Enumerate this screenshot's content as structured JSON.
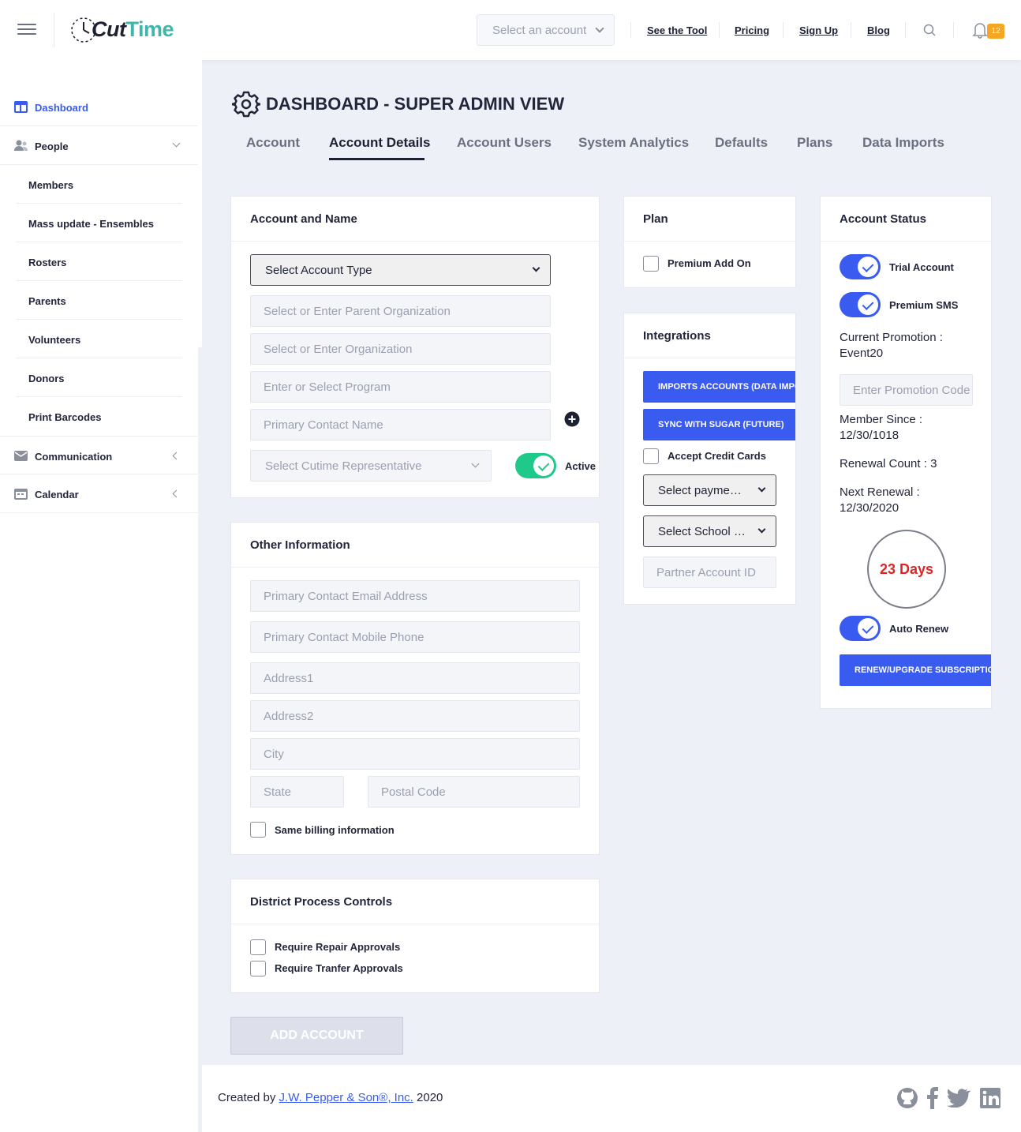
{
  "header": {
    "logo_prefix": "Cut",
    "logo_suffix": "Time",
    "account_select_placeholder": "Select an account",
    "nav": [
      {
        "label": "See the Tool"
      },
      {
        "label": "Pricing"
      },
      {
        "label": "Sign Up"
      },
      {
        "label": "Blog"
      }
    ],
    "notification_count": "12"
  },
  "sidebar": {
    "items": [
      {
        "label": "Dashboard",
        "icon": "dashboard-icon",
        "active": true
      },
      {
        "label": "People",
        "icon": "people-icon"
      },
      {
        "label": "Communication",
        "icon": "mail-icon"
      },
      {
        "label": "Calendar",
        "icon": "calendar-icon"
      }
    ],
    "people_sub": [
      {
        "label": "Members"
      },
      {
        "label": "Mass update - Ensembles"
      },
      {
        "label": "Rosters"
      },
      {
        "label": "Parents"
      },
      {
        "label": "Volunteers"
      },
      {
        "label": "Donors"
      },
      {
        "label": "Print Barcodes"
      }
    ]
  },
  "page": {
    "title": "DASHBOARD - SUPER ADMIN VIEW",
    "tabs": [
      {
        "label": "Account"
      },
      {
        "label": "Account Details",
        "active": true
      },
      {
        "label": "Account Users"
      },
      {
        "label": "System Analytics"
      },
      {
        "label": "Defaults"
      },
      {
        "label": "Plans"
      },
      {
        "label": "Data Imports"
      }
    ]
  },
  "account_name": {
    "title": "Account and Name",
    "account_type": "Select Account Type",
    "parent_org": "Select or Enter Parent Organization",
    "organization": "Select or Enter Organization",
    "program": "Enter or Select Program",
    "primary_contact": "Primary Contact Name",
    "representative": "Select Cutime Representative",
    "active_label": "Active"
  },
  "other_info": {
    "title": "Other Information",
    "email": "Primary Contact Email Address",
    "mobile": "Primary Contact Mobile Phone",
    "address1": "Address1",
    "address2": "Address2",
    "city": "City",
    "state": "State",
    "postal": "Postal Code",
    "same_billing": "Same billing information"
  },
  "district": {
    "title": "District Process Controls",
    "repair": "Require Repair Approvals",
    "transfer": "Require Tranfer Approvals"
  },
  "add_account": "ADD ACCOUNT",
  "plan": {
    "title": "Plan",
    "premium_addon": "Premium Add On"
  },
  "integrations": {
    "title": "Integrations",
    "imports_btn": "IMPORTS ACCOUNTS (DATA IMPORTS)",
    "sync_btn": "SYNC WITH SUGAR (FUTURE)",
    "accept_cards": "Accept Credit Cards",
    "payment_select": "Select payment processor",
    "school_select": "Select School System",
    "partner_id": "Partner Account ID"
  },
  "status": {
    "title": "Account Status",
    "trial": "Trial Account",
    "premium_sms": "Premium SMS",
    "promo_label": "Current Promotion :",
    "promo_value": "Event20",
    "promo_input": "Enter Promotion Code",
    "member_since_label": "Member Since :",
    "member_since_value": "12/30/1018",
    "renewal_count": "Renewal Count : 3",
    "next_renewal_label": "Next Renewal :",
    "next_renewal_value": "12/30/2020",
    "days_left": "23 Days",
    "auto_renew": "Auto Renew",
    "renew_btn": "RENEW/UPGRADE SUBSCRIPTION"
  },
  "footer": {
    "created_by": "Created by",
    "company": "J.W. Pepper & Son®, Inc.",
    "year": "2020"
  },
  "colors": {
    "accent": "#3a5bf0",
    "teal": "#3fb6a8",
    "green": "#1ec98a",
    "danger": "#e02424",
    "badge": "#f5a623"
  }
}
